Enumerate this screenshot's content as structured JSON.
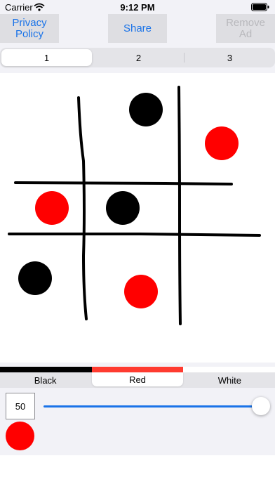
{
  "status_bar": {
    "carrier": "Carrier",
    "time": "9:12 PM"
  },
  "toolbar": {
    "privacy_label": "Privacy Policy",
    "share_label": "Share",
    "remove_ad_label": "Remove Ad",
    "active_color": "#1a73e8",
    "disabled_color": "#b8b8bc"
  },
  "pages": {
    "items": [
      "1",
      "2",
      "3"
    ],
    "selected": 0
  },
  "drawing": {
    "description_free": true,
    "pieces": [
      {
        "color": "black",
        "row": 0,
        "col": 1
      },
      {
        "color": "red",
        "row": 0,
        "col": 2
      },
      {
        "color": "red",
        "row": 1,
        "col": 0
      },
      {
        "color": "black",
        "row": 1,
        "col": 1
      },
      {
        "color": "black",
        "row": 2,
        "col": 0
      },
      {
        "color": "red",
        "row": 2,
        "col": 1
      }
    ],
    "colors": {
      "black": "#000000",
      "red": "#ff0000"
    }
  },
  "palette": {
    "items": [
      {
        "label": "Black",
        "color": "#000000"
      },
      {
        "label": "Red",
        "color": "#ff3b30"
      },
      {
        "label": "White",
        "color": "#ffffff"
      }
    ],
    "selected": 1
  },
  "brush": {
    "size": "50",
    "size_fraction": 1.0,
    "preview_color": "#ff0000"
  }
}
